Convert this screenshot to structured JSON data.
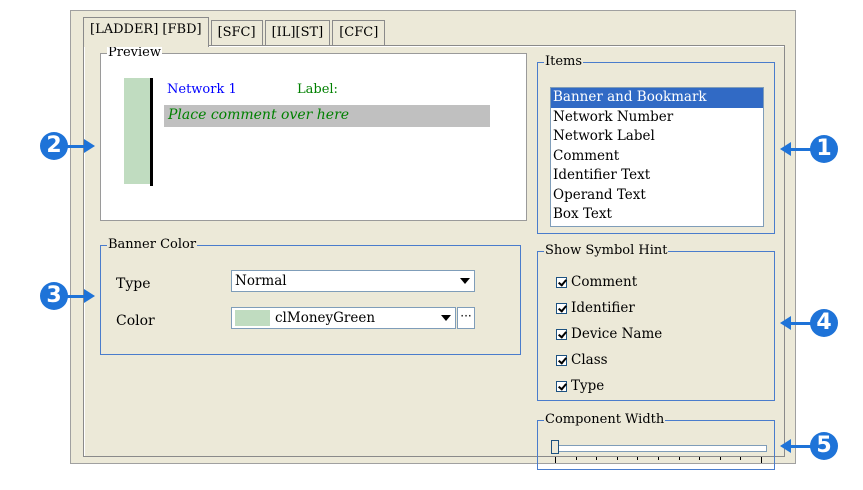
{
  "tabs": [
    "[LADDER] [FBD]",
    "[SFC]",
    "[IL][ST]",
    "[CFC]"
  ],
  "preview": {
    "title": "Preview",
    "network_label": "Network 1",
    "label_text": "Label:",
    "comment_text": "Place comment over here"
  },
  "items": {
    "title": "Items",
    "list": [
      "Banner and Bookmark",
      "Network Number",
      "Network Label",
      "Comment",
      "Identifier Text",
      "Operand Text",
      "Box Text"
    ],
    "selected": "Banner and Bookmark"
  },
  "banner_color": {
    "title": "Banner Color",
    "type_label": "Type",
    "type_value": "Normal",
    "color_label": "Color",
    "color_value": "clMoneyGreen",
    "color_swatch": "#c0dcc0",
    "ellipsis": "···"
  },
  "symbol_hint": {
    "title": "Show Symbol Hint",
    "options": [
      "Comment",
      "Identifier",
      "Device Name",
      "Class",
      "Type"
    ]
  },
  "component_width": {
    "title": "Component Width",
    "level": 0
  },
  "callouts": [
    "1",
    "2",
    "3",
    "4",
    "5"
  ],
  "colors": {
    "accent": "#1e73d8",
    "selection": "#316ac5",
    "banner_green": "#c0dcc0",
    "network_blue": "#0000ff",
    "label_green": "#008000"
  }
}
